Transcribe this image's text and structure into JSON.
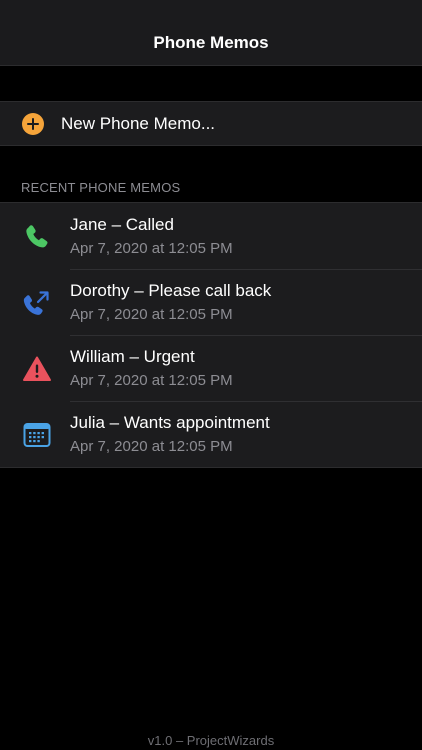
{
  "header": {
    "title": "Phone Memos"
  },
  "new_memo": {
    "label": "New Phone Memo...",
    "icon": "plus-circle-icon",
    "icon_color": "#f5a43a"
  },
  "recent": {
    "section_title": "RECENT PHONE MEMOS",
    "items": [
      {
        "title": "Jane – Called",
        "date": "Apr 7, 2020 at 12:05 PM",
        "icon": "phone-icon",
        "icon_color": "#4cc764"
      },
      {
        "title": "Dorothy – Please call back",
        "date": "Apr 7, 2020 at 12:05 PM",
        "icon": "phone-callback-icon",
        "icon_color": "#3a73d8"
      },
      {
        "title": "William – Urgent",
        "date": "Apr 7, 2020 at 12:05 PM",
        "icon": "warning-icon",
        "icon_color": "#e9525d"
      },
      {
        "title": "Julia – Wants appointment",
        "date": "Apr 7, 2020 at 12:05 PM",
        "icon": "calendar-icon",
        "icon_color": "#4aa3e6"
      }
    ]
  },
  "footer": {
    "version": "v1.0 – ProjectWizards"
  }
}
